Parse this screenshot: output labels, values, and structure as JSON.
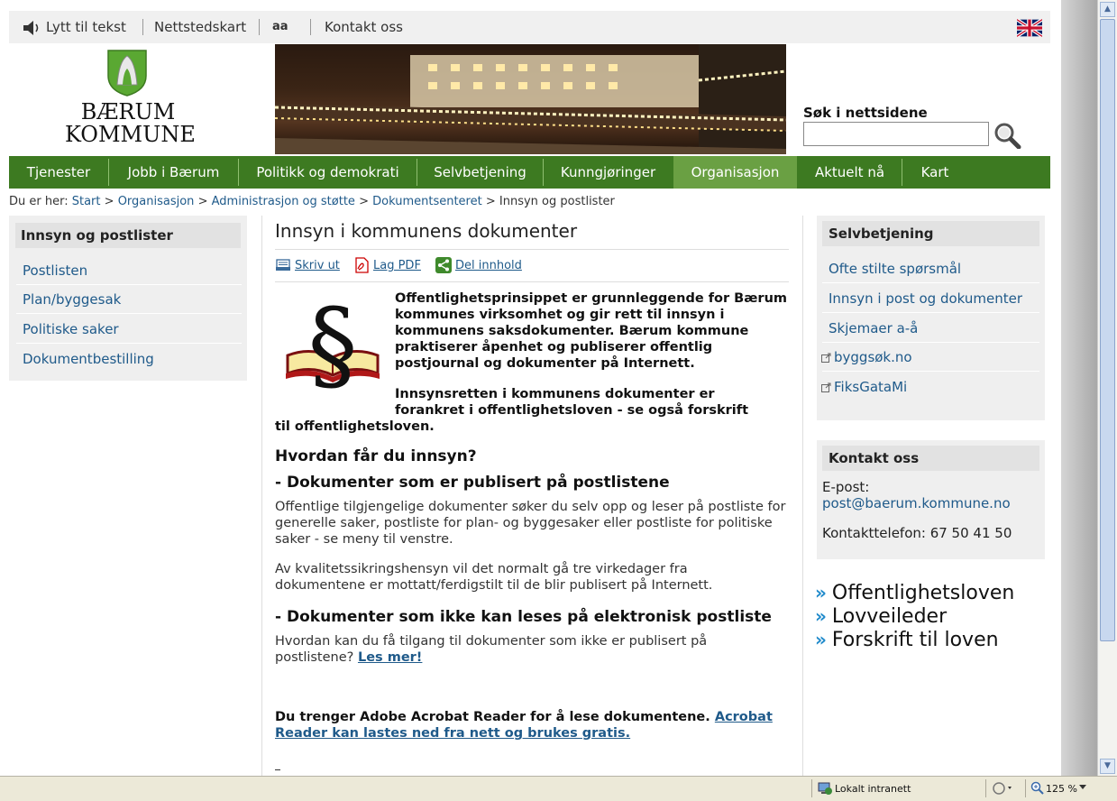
{
  "utility": {
    "listen": "Lytt til tekst",
    "sitemap": "Nettstedskart",
    "textsize": "aa",
    "contact": "Kontakt oss"
  },
  "logo": {
    "line1": "BÆRUM",
    "line2": "KOMMUNE"
  },
  "search": {
    "label": "Søk i nettsidene",
    "value": ""
  },
  "nav": [
    {
      "label": "Tjenester"
    },
    {
      "label": "Jobb i Bærum"
    },
    {
      "label": "Politikk og demokrati"
    },
    {
      "label": "Selvbetjening"
    },
    {
      "label": "Kunngjøringer"
    },
    {
      "label": "Organisasjon"
    },
    {
      "label": "Aktuelt nå"
    },
    {
      "label": "Kart"
    }
  ],
  "breadcrumb": {
    "prefix": "Du er her:",
    "items": [
      "Start",
      "Organisasjon",
      "Administrasjon og støtte",
      "Dokumentsenteret"
    ],
    "current": "Innsyn og postlister",
    "sep": ">"
  },
  "left": {
    "heading": "Innsyn og postlister",
    "items": [
      "Postlisten",
      "Plan/byggesak",
      "Politiske saker",
      "Dokumentbestilling"
    ]
  },
  "content": {
    "title": "Innsyn i kommunens dokumenter",
    "tools": [
      "Skriv ut",
      "Lag PDF",
      "Del innhold"
    ],
    "intro1": "Offentlighetsprinsippet er grunnleggende for Bærum kommunes virksomhet og gir rett til innsyn i kommunens saksdokumenter. Bærum kommune praktiserer åpenhet og publiserer offentlig postjournal og dokumenter på Internett.",
    "intro2": "Innsynsretten i kommunens dokumenter er forankret i offentlighetsloven - se også forskrift til offentlighetsloven.",
    "h_how": "Hvordan får du innsyn?",
    "h_pub": "- Dokumenter som er publisert på postlistene",
    "p_pub1": "Offentlige tilgjengelige dokumenter søker du selv opp og leser på postliste for generelle saker, postliste for plan- og byggesaker eller postliste for politiske saker -  se meny til venstre.",
    "p_pub2": "Av kvalitetssikringshensyn vil det normalt gå tre virkedager fra dokumentene er mottatt/ferdigstilt til de blir publisert på Internett.",
    "h_notpub": "- Dokumenter som ikke kan leses på elektronisk postliste",
    "p_notpub": "Hvordan kan du få tilgang til dokumenter som ikke er publisert på postlistene?",
    "p_notpub_link": "Les mer!",
    "acrobat": "Du trenger Adobe Acrobat Reader for å lese dokumentene.",
    "acrobat_link": "Acrobat Reader kan lastes ned fra nett og brukes gratis."
  },
  "right": {
    "self": {
      "heading": "Selvbetjening",
      "items": [
        "Ofte stilte spørsmål",
        "Innsyn i post og dokumenter",
        "Skjemaer a-å",
        "byggsøk.no",
        "FiksGataMi"
      ]
    },
    "contact": {
      "heading": "Kontakt oss",
      "email_label": "E-post:",
      "email": "post@baerum.kommune.no",
      "phone": "Kontakttelefon: 67 50 41 50"
    },
    "links": [
      "Offentlighetsloven",
      "Lovveileder",
      "Forskrift til loven"
    ]
  },
  "statusbar": {
    "zone": "Lokalt intranett",
    "zoom": "125 %"
  }
}
